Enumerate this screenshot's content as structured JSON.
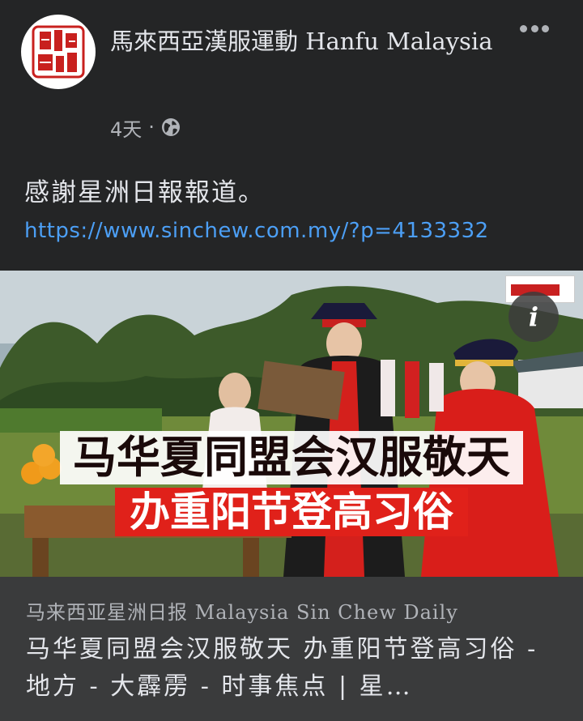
{
  "page": {
    "name": "馬來西亞漢服運動 Hanfu Malaysia",
    "time": "4天",
    "separator": "·",
    "privacy_icon": "globe-icon",
    "avatar_icon": "red-seal-logo"
  },
  "post": {
    "caption": "感謝星洲日報報道。",
    "link": "https://www.sinchew.com.my/?p=4133332"
  },
  "image": {
    "headline_line1": "马华夏同盟会汉服敬天",
    "headline_line2": "办重阳节登高习俗",
    "info_label": "i"
  },
  "preview": {
    "domain": "马来西亚星洲日报 Malaysia Sin Chew Daily",
    "title": "马华夏同盟会汉服敬天 办重阳节登高习俗 - 地方 - 大霹雳 - 时事焦点 | 星…"
  },
  "colors": {
    "background": "#242526",
    "link": "#4c9ff5",
    "seal_red": "#c8201e",
    "headline_red": "#e0211a",
    "preview_bg": "#3a3b3c"
  }
}
